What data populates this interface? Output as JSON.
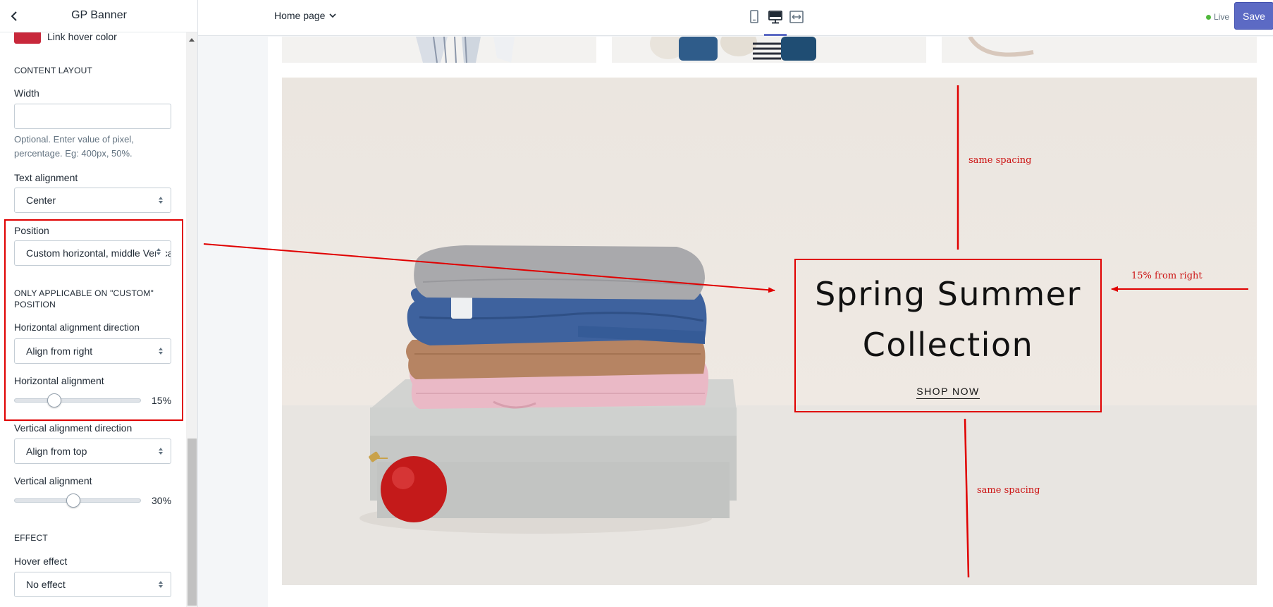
{
  "sidebar": {
    "title": "GP Banner",
    "link_hover_label": "Link hover color",
    "link_hover_color": "#c8283b",
    "content_layout_heading": "CONTENT LAYOUT",
    "width": {
      "label": "Width",
      "value": "",
      "help": "Optional. Enter value of pixel, percentage. Eg: 400px, 50%."
    },
    "text_alignment": {
      "label": "Text alignment",
      "value": "Center"
    },
    "position": {
      "label": "Position",
      "value": "Custom horizontal, middle Vertical"
    },
    "custom_heading": "ONLY APPLICABLE ON \"CUSTOM\" POSITION",
    "h_direction": {
      "label": "Horizontal alignment direction",
      "value": "Align from right"
    },
    "h_alignment": {
      "label": "Horizontal alignment",
      "value": "15%",
      "level": 0.15
    },
    "v_direction": {
      "label": "Vertical alignment direction",
      "value": "Align from top"
    },
    "v_alignment": {
      "label": "Vertical alignment",
      "value": "30%",
      "level": 0.3
    },
    "effect_heading": "EFFECT",
    "hover_effect": {
      "label": "Hover effect",
      "value": "No effect"
    }
  },
  "topbar": {
    "page_select": "Home page",
    "devices": [
      "mobile-icon",
      "desktop-icon",
      "full-width-icon"
    ],
    "active_device": "desktop",
    "live_label": "Live",
    "save_label": "Save"
  },
  "banner": {
    "title_line1": "Spring Summer",
    "title_line2": "Collection",
    "cta": "SHOP NOW"
  },
  "annotations": {
    "top_spacing": "same spacing",
    "bottom_spacing": "same spacing",
    "right_offset": "15% from right",
    "color": "#e00000"
  }
}
